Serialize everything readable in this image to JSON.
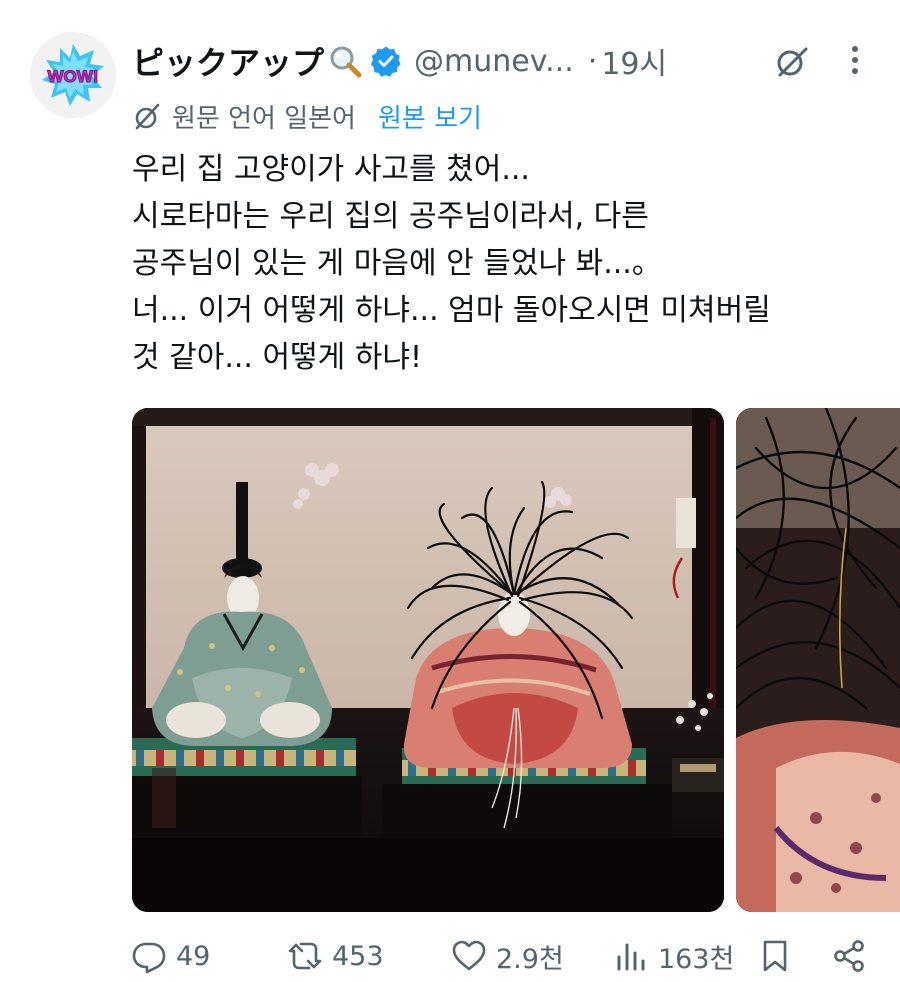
{
  "author": {
    "display_name": "ピックアップ",
    "handle": "@munev...",
    "avatar_text": "WOW!"
  },
  "timestamp": "19시",
  "dot": "·",
  "translation": {
    "label": "원문 언어 일본어",
    "show_original": "원본 보기"
  },
  "tweet": {
    "lines": [
      "우리 집 고양이가 사고를 쳤어...",
      "시로타마는 우리 집의 공주님이라서, 다른",
      "공주님이 있는 게 마음에 안 들었나 봐...。",
      "너... 이거 어떻게 하냐... 엄마 돌아오시면 미쳐버릴",
      "것 같아... 어떻게 하냐!"
    ]
  },
  "metrics": {
    "replies": "49",
    "retweets": "453",
    "likes": "2.9천",
    "views": "163천"
  },
  "icons": {
    "verified": "verified-badge-icon",
    "name_emoji": "magnifier-emoji-icon",
    "grok": "grok-icon",
    "more": "more-icon",
    "translate": "translate-icon",
    "reply": "reply-icon",
    "retweet": "retweet-icon",
    "like": "heart-icon",
    "views": "views-icon",
    "bookmark": "bookmark-icon",
    "share": "share-icon"
  },
  "colors": {
    "accent": "#1d9bf0",
    "muted": "#536471",
    "text": "#0f1419"
  }
}
